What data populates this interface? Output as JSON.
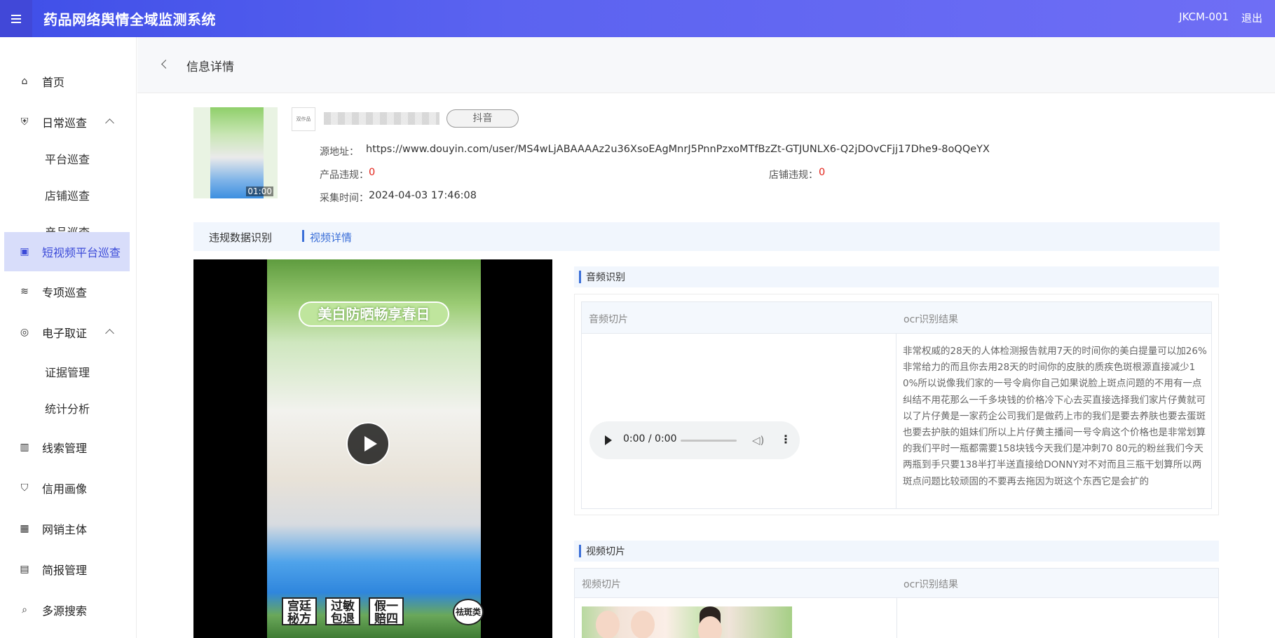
{
  "header": {
    "title": "药品网络舆情全域监测系统",
    "user_code": "JKCM-001",
    "logout_label": "退出"
  },
  "sidebar": {
    "items": [
      {
        "label": "首页",
        "icon": "home-icon"
      },
      {
        "label": "日常巡查",
        "icon": "shield-icon",
        "expanded": true
      },
      {
        "label": "平台巡查"
      },
      {
        "label": "店铺巡查"
      },
      {
        "label": "产品巡查"
      },
      {
        "label": "短视频平台巡查",
        "icon": "video-platform-icon",
        "active": true
      },
      {
        "label": "专项巡查",
        "icon": "layers-icon"
      },
      {
        "label": "电子取证",
        "icon": "evidence-icon",
        "expanded": true
      },
      {
        "label": "证据管理"
      },
      {
        "label": "统计分析"
      },
      {
        "label": "线索管理",
        "icon": "clue-icon"
      },
      {
        "label": "信用画像",
        "icon": "credit-icon"
      },
      {
        "label": "网销主体",
        "icon": "building-icon"
      },
      {
        "label": "简报管理",
        "icon": "report-icon"
      },
      {
        "label": "多源搜索",
        "icon": "search-icon"
      }
    ]
  },
  "page": {
    "title": "信息详情"
  },
  "account": {
    "logo_text": "双作品",
    "platform": "抖音",
    "thumb_duration": "01:00"
  },
  "meta": {
    "source_label": "源地址：",
    "source_url": "https://www.douyin.com/user/MS4wLjABAAAAz2u36XsoEAgMnrJ5PnnPzxoMTfBzZt-GTJUNLX6-Q2jDOvCFjj17Dhe9-8oQQeYX",
    "product_violation_label": "产品违规：",
    "product_violation_value": "0",
    "store_violation_label": "店铺违规：",
    "store_violation_value": "0",
    "collect_time_label": "采集时间：",
    "collect_time_value": "2024-04-03 17:46:08"
  },
  "tabs": [
    {
      "label": "违规数据识别",
      "active": false
    },
    {
      "label": "视频详情",
      "active": true
    }
  ],
  "video": {
    "banner_text": "美白防晒畅享春日",
    "stamps": [
      "宫廷秘方",
      "过敏包退",
      "假一赔四"
    ],
    "badge": "祛斑类"
  },
  "audio_section": {
    "title": "音频识别",
    "columns": [
      "音频切片",
      "ocr识别结果"
    ],
    "player_time": "0:00 / 0:00",
    "ocr_text": "非常权威的28天的人体检测报告就用7天的时间你的美白提量可以加26%非常给力的而且你去用28天的时间你的皮肤的质疾色斑根源直接减少10%所以说像我们家的一号令肩你自己如果说脸上斑点问题的不用有一点纠结不用花那么一千多块钱的价格冷下心去买直接选择我们家片仔黄就可以了片仔黄是一家药企公司我们是做药上市的我们是要去养肤也要去蛋斑也要去护肤的姐妹们所以上片仔黄主播间一号令肩这个价格也是非常划算的我们平时一瓶都需要158块钱今天我们是冲刺70 80元的粉丝我们今天两瓶到手只要138半打半送直接给DONNY对不对而且三瓶干划算所以两斑点问题比较顽固的不要再去拖因为斑这个东西它是会扩的"
  },
  "video_section": {
    "title": "视频切片",
    "columns": [
      "视频切片",
      "ocr识别结果"
    ]
  },
  "colors": {
    "header_start": "#3f4fe8",
    "accent": "#3b6fd8",
    "active_nav_bg": "#d8ddfa",
    "violation_red": "#e2231a"
  }
}
